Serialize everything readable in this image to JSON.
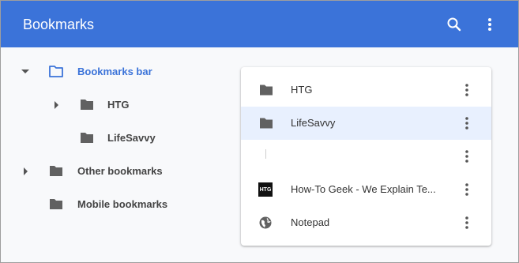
{
  "header": {
    "title": "Bookmarks",
    "search_icon": "search-icon",
    "menu_icon": "more-vert-icon",
    "background": "#3b73d9"
  },
  "sidebar": {
    "items": [
      {
        "label": "Bookmarks bar",
        "state": "expanded",
        "selected": true,
        "icon": "folder-outline-icon"
      },
      {
        "label": "HTG",
        "state": "collapsed",
        "selected": false,
        "icon": "folder-icon"
      },
      {
        "label": "LifeSavvy",
        "state": "leaf",
        "selected": false,
        "icon": "folder-icon"
      },
      {
        "label": "Other bookmarks",
        "state": "collapsed",
        "selected": false,
        "icon": "folder-icon"
      },
      {
        "label": "Mobile bookmarks",
        "state": "leaf",
        "selected": false,
        "icon": "folder-icon"
      }
    ]
  },
  "list": {
    "rows": [
      {
        "title": "HTG",
        "icon": "folder-icon",
        "selected": false
      },
      {
        "title": "LifeSavvy",
        "icon": "folder-icon",
        "selected": true
      },
      {
        "title": "",
        "icon": "blank-favicon",
        "selected": false
      },
      {
        "title": "How-To Geek - We Explain Te...",
        "icon": "htg-favicon",
        "favicon_text": "HTG",
        "selected": false
      },
      {
        "title": "Notepad",
        "icon": "globe-icon",
        "selected": false
      }
    ]
  },
  "colors": {
    "accent": "#3b73d9",
    "selected_row": "#e8f0fe",
    "folder": "#616161"
  }
}
